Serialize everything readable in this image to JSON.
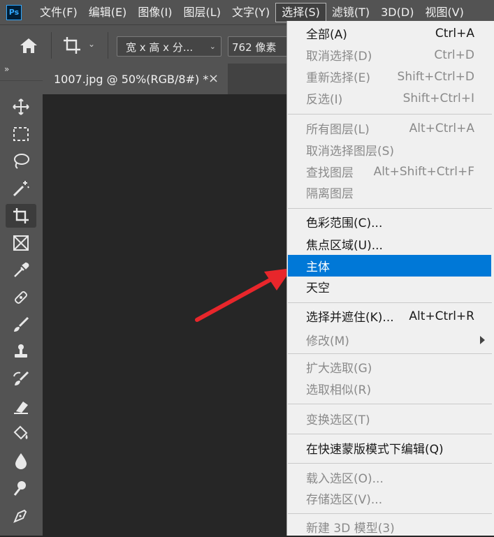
{
  "app": {
    "logo_text": "Ps"
  },
  "menubar": {
    "items": [
      "文件(F)",
      "编辑(E)",
      "图像(I)",
      "图层(L)",
      "文字(Y)",
      "选择(S)",
      "滤镜(T)",
      "3D(D)",
      "视图(V)"
    ],
    "active_index": 5
  },
  "options": {
    "ratio_value": "宽 x 高 x 分...",
    "width_value": "762 像素"
  },
  "toolbar": {
    "collapse_glyph": "»",
    "tools": [
      "move-icon",
      "marquee-icon",
      "lasso-icon",
      "magic-wand-icon",
      "crop-icon",
      "frame-icon",
      "eyedropper-icon",
      "healing-brush-icon",
      "brush-icon",
      "clone-stamp-icon",
      "history-brush-icon",
      "eraser-icon",
      "paint-bucket-icon",
      "blur-icon",
      "dodge-icon",
      "pen-icon"
    ],
    "selected_tool": "crop-icon"
  },
  "document": {
    "tab_title": "1007.jpg @ 50%(RGB/8#) *",
    "close_glyph": "×"
  },
  "select_menu": {
    "items": [
      {
        "label": "全部(A)",
        "shortcut": "Ctrl+A",
        "disabled": false
      },
      {
        "label": "取消选择(D)",
        "shortcut": "Ctrl+D",
        "disabled": true
      },
      {
        "label": "重新选择(E)",
        "shortcut": "Shift+Ctrl+D",
        "disabled": true
      },
      {
        "label": "反选(I)",
        "shortcut": "Shift+Ctrl+I",
        "disabled": true
      },
      {
        "label": "所有图层(L)",
        "shortcut": "Alt+Ctrl+A",
        "disabled": true
      },
      {
        "label": "取消选择图层(S)",
        "shortcut": "",
        "disabled": true
      },
      {
        "label": "查找图层",
        "shortcut": "Alt+Shift+Ctrl+F",
        "disabled": true
      },
      {
        "label": "隔离图层",
        "shortcut": "",
        "disabled": true
      },
      {
        "label": "色彩范围(C)...",
        "shortcut": "",
        "disabled": false
      },
      {
        "label": "焦点区域(U)...",
        "shortcut": "",
        "disabled": false
      },
      {
        "label": "主体",
        "shortcut": "",
        "disabled": false,
        "highlighted": true
      },
      {
        "label": "天空",
        "shortcut": "",
        "disabled": false
      },
      {
        "label": "选择并遮住(K)...",
        "shortcut": "Alt+Ctrl+R",
        "disabled": false
      },
      {
        "label": "修改(M)",
        "shortcut": "",
        "disabled": true,
        "has_submenu": true
      },
      {
        "label": "扩大选取(G)",
        "shortcut": "",
        "disabled": true
      },
      {
        "label": "选取相似(R)",
        "shortcut": "",
        "disabled": true
      },
      {
        "label": "变换选区(T)",
        "shortcut": "",
        "disabled": true
      },
      {
        "label": "在快速蒙版模式下编辑(Q)",
        "shortcut": "",
        "disabled": false
      },
      {
        "label": "载入选区(O)...",
        "shortcut": "",
        "disabled": true
      },
      {
        "label": "存储选区(V)...",
        "shortcut": "",
        "disabled": true
      },
      {
        "label": "新建 3D 模型(3)",
        "shortcut": "",
        "disabled": true
      }
    ]
  },
  "colors": {
    "highlight": "#0078d7",
    "annotation_arrow": "#e8262b"
  }
}
